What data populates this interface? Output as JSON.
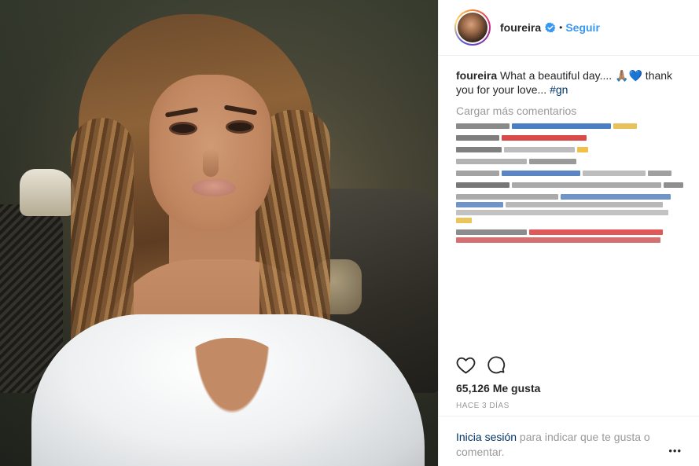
{
  "post": {
    "username": "foureira",
    "follow_label": "Seguir",
    "separator": "•",
    "caption": {
      "username": "foureira",
      "text": " What a beautiful day.... 🙏🏽💙 thank you for your love... ",
      "hashtag": "#gn"
    },
    "load_more_label": "Cargar más comentarios",
    "likes_label": "65,126 Me gusta",
    "timestamp_label": "HACE 3 DÍAS",
    "footer": {
      "login_label": "Inicia sesión",
      "rest_text": " para indicar que te gusta o comentar."
    },
    "more_label": "•••"
  },
  "colors": {
    "link_blue": "#3897f0",
    "dark_link": "#003569",
    "muted": "#999999",
    "verified": "#3897f0"
  },
  "icons": {
    "like": "heart-icon",
    "comment": "comment-bubble-icon",
    "verified": "verified-badge-icon",
    "more": "more-options-icon"
  }
}
